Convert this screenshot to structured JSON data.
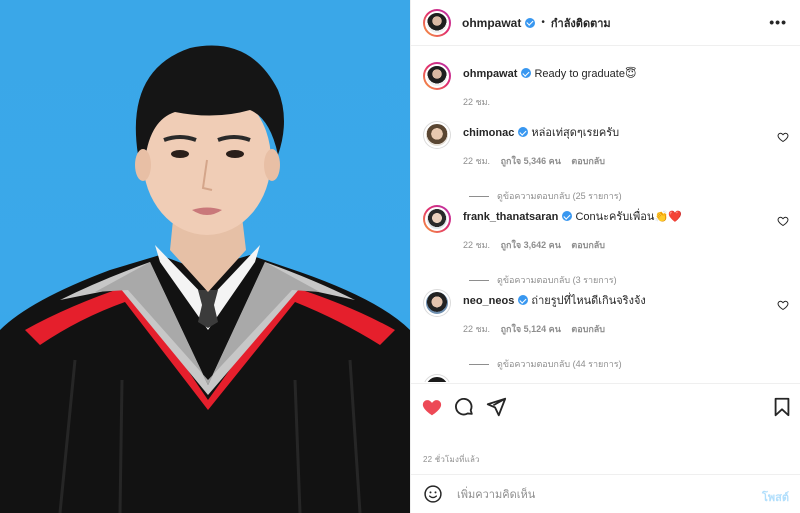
{
  "photo": {
    "alt_icon": "graduation-portrait"
  },
  "header": {
    "username": "ohmpawat",
    "separator": "•",
    "follow_label": "กำลังติดตาม",
    "more_label": "•••"
  },
  "caption": {
    "username": "ohmpawat",
    "text": "Ready to graduate",
    "emoji": "😇",
    "time": "22 ชม."
  },
  "comments": [
    {
      "username": "chimonac",
      "text": "หล่อเท่สุดๆเรยครับ",
      "time": "22 ชม.",
      "likes": "ถูกใจ 5,346 คน",
      "reply_label": "ตอบกลับ",
      "view_replies": "ดูข้อความตอบกลับ (25 รายการ)"
    },
    {
      "username": "frank_thanatsaran",
      "text": "Conนะครับเพื่อน",
      "emoji": "👏❤️",
      "time": "22 ชม.",
      "likes": "ถูกใจ 3,642 คน",
      "reply_label": "ตอบกลับ",
      "view_replies": "ดูข้อความตอบกลับ (3 รายการ)"
    },
    {
      "username": "neo_neos",
      "text": "ถ่ายรูปที่ไหนดีเกินจริงจ้ง",
      "time": "22 ชม.",
      "likes": "ถูกใจ 5,124 คน",
      "reply_label": "ตอบกลับ",
      "view_replies": "ดูข้อความตอบกลับ (44 รายการ)"
    }
  ],
  "footer": {
    "timestamp": "22 ชั่วโมงที่แล้ว",
    "comment_placeholder": "เพิ่มความคิดเห็น",
    "post_label": "โพสต์"
  },
  "colors": {
    "like_red": "#ed4956",
    "verified_blue": "#3897f0",
    "post_disabled": "#b2dffc",
    "sky_blue": "#3aa7e8"
  }
}
